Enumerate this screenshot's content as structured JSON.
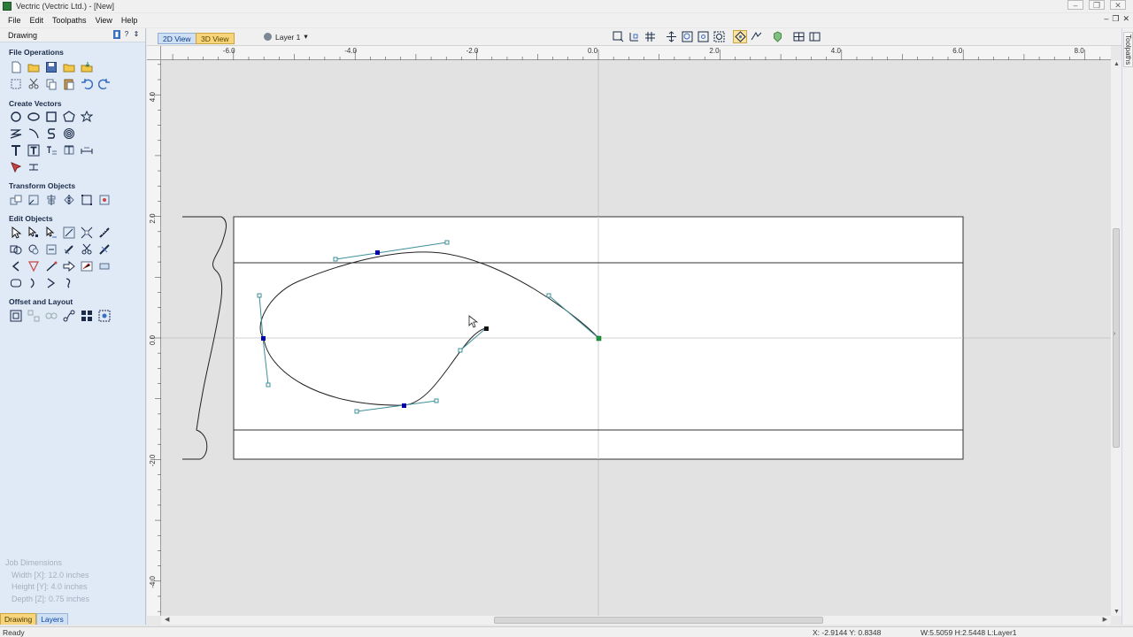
{
  "window": {
    "title": "Vectric (Vectric Ltd.) - [New]",
    "controls": [
      "–",
      "❐",
      "✕"
    ],
    "mdi_controls": [
      "–",
      "❐",
      "✕"
    ]
  },
  "menu": [
    "File",
    "Edit",
    "Toolpaths",
    "View",
    "Help"
  ],
  "panel": {
    "header": "Drawing",
    "header_buttons": [
      "▮",
      "?",
      "⇕"
    ],
    "sections": {
      "file_ops": "File Operations",
      "create_vectors": "Create Vectors",
      "transform": "Transform Objects",
      "edit_objects": "Edit Objects",
      "offset_layout": "Offset and Layout"
    },
    "job_dims": {
      "title": "Job Dimensions",
      "width": "Width  [X]: 12.0 inches",
      "height": "Height [Y]: 4.0 inches",
      "depth": "Depth  [Z]: 0.75 inches"
    },
    "tabs": [
      "Drawing",
      "Layers"
    ]
  },
  "view_tabs": {
    "tab_2d": "2D View",
    "tab_3d": "3D View"
  },
  "layer": {
    "name": "Layer 1",
    "arrow": "▾"
  },
  "right_tab": "Toolpaths",
  "rulers": {
    "x_labels": [
      "-6.0",
      "-4.0",
      "-2.0",
      "0.0",
      "2.0",
      "4.0",
      "6.0",
      "8.0"
    ],
    "y_labels": [
      "4.0",
      "2.0",
      "0.0",
      "-2.0",
      "-4.0"
    ]
  },
  "status": {
    "text": "Ready",
    "coords": "X: -2.9144 Y: 0.8348",
    "dims": "W:5.5059   H:2.5448   L:Layer1"
  },
  "colors": {
    "panel_bg": "#dfeaf6",
    "canvas_bg": "#e2e2e2",
    "node_blue": "#0000aa",
    "node_green": "#1a9a3a",
    "handle": "#3e8f9a",
    "tab_active": "#f8d57a"
  }
}
